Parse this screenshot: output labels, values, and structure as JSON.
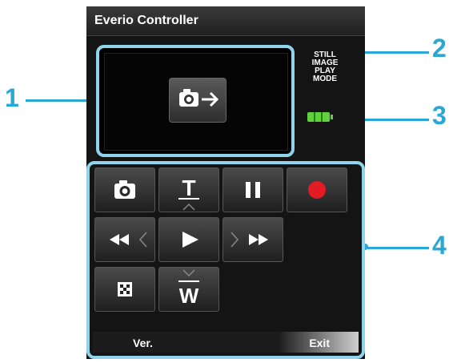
{
  "title": "Everio Controller",
  "mode_label": [
    "STILL",
    "IMAGE",
    "PLAY",
    "MODE"
  ],
  "callouts": [
    "1",
    "2",
    "3",
    "4"
  ],
  "footer": {
    "ver": "Ver.",
    "exit": "Exit"
  },
  "colors": {
    "accent": "#29a8d6",
    "frame": "#8fd3ec",
    "record": "#e31b23",
    "battery": "#5fd33b"
  },
  "icons": [
    "camera-to-arrow-icon",
    "camera-icon",
    "tele-zoom-icon",
    "pause-icon",
    "record-icon",
    "rewind-icon",
    "play-icon",
    "fast-forward-icon",
    "index-icon",
    "wide-zoom-icon"
  ]
}
